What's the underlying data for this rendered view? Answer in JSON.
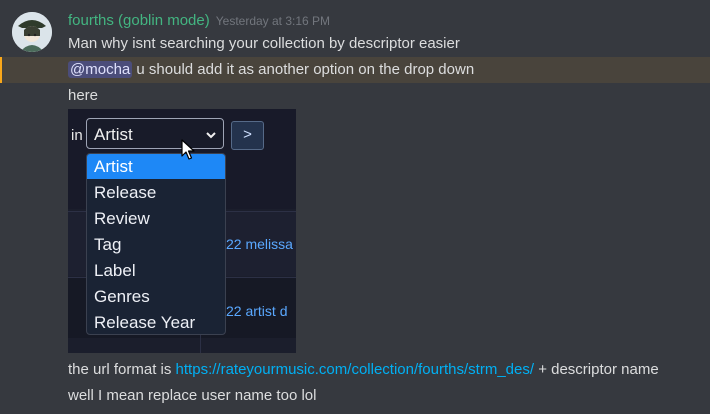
{
  "message": {
    "username": "fourths (goblin mode)",
    "timestamp": "Yesterday at 3:16 PM",
    "line1": "Man why isnt searching your collection by descriptor easier",
    "mention": "@mocha",
    "line2_rest": " u should add it as another option on the drop down",
    "line3": "here",
    "line4_prefix": "the url format is ",
    "line4_link": "https://rateyourmusic.com/collection/fourths/strm_des/",
    "line4_suffix": " + descriptor name",
    "line5": "well I mean replace user name too lol"
  },
  "embed": {
    "in_label": "in",
    "select_value": "Artist",
    "go_label": ">",
    "options": [
      "Artist",
      "Release",
      "Review",
      "Tag",
      "Label",
      "Genres",
      "Release Year"
    ],
    "selected_index": 0,
    "row1_text": "22  melissa",
    "row2_text": "22  artist d"
  },
  "colors": {
    "username": "#43b581",
    "link": "#00b0f4",
    "mention_bg": "#4b4d7a",
    "highlight_bg": "#49443c",
    "selected_option": "#1e88f6"
  },
  "icons": {
    "avatar": "avatar-image",
    "chevron": "chevron-down-icon",
    "cursor": "mouse-pointer-icon"
  }
}
